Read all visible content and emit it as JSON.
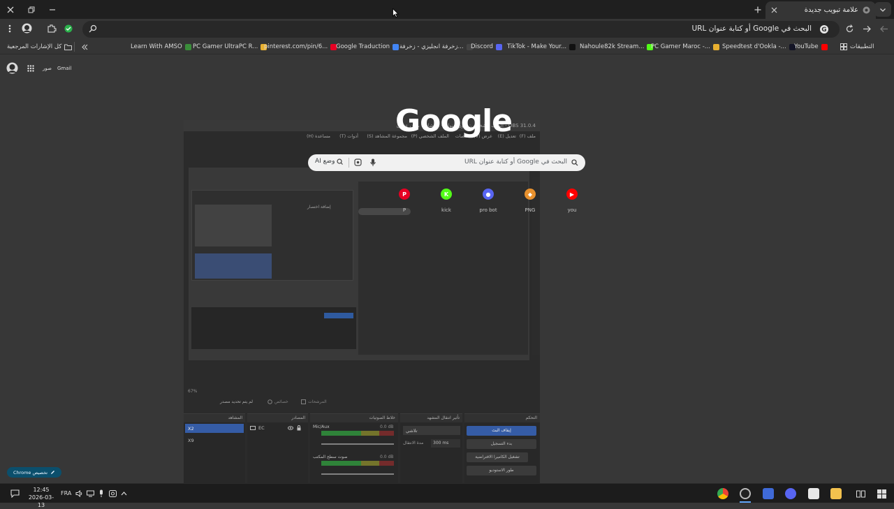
{
  "tabs": {
    "active_title": "علامة تبويب جديدة"
  },
  "omnibox": {
    "text": "البحث في Google أو كتابة عنوان URL"
  },
  "bookmarks": {
    "all_bookmarks": "كل الإشارات المرجعية",
    "apps": "التطبيقات",
    "items": [
      {
        "label": "Learn With AMSO",
        "color": "#3a8d3a"
      },
      {
        "label": "PC Gamer UltraPC R...",
        "color": "#e8b030"
      },
      {
        "label": "pinterest.com/pin/6...",
        "color": "#e60023"
      },
      {
        "label": "Google Traduction",
        "color": "#4285f4"
      },
      {
        "label": "زخرفة انجليزي - زخرفة...",
        "color": "#444444"
      },
      {
        "label": "Discord",
        "color": "#5865f2"
      },
      {
        "label": "TikTok - Make Your...",
        "color": "#111111"
      },
      {
        "label": "Nahoule82k Stream...",
        "color": "#53fc18"
      },
      {
        "label": "PC Gamer Maroc -...",
        "color": "#e8b030"
      },
      {
        "label": "Speedtest d'Ookla -...",
        "color": "#141526"
      },
      {
        "label": "YouTube",
        "color": "#ff0000"
      }
    ]
  },
  "ntp": {
    "gmail": "Gmail",
    "images": "صور",
    "logo": "Google",
    "search_placeholder": "البحث في Google أو كتابة عنوان URL",
    "ai_mode": "وضع AI",
    "shortcuts": [
      {
        "label": "you",
        "color": "#ff0000",
        "glyph": "▶"
      },
      {
        "label": "PNG",
        "color": "#e8912e",
        "glyph": "◆"
      },
      {
        "label": "pro bot",
        "color": "#5865f2",
        "glyph": "●"
      },
      {
        "label": "kick",
        "color": "#53fc18",
        "glyph": "K"
      },
      {
        "label": "P",
        "color": "#e60023",
        "glyph": "P"
      }
    ],
    "customize": "تخصيص Chrome"
  },
  "obs": {
    "title": "OBS 31.0.4 - الملف الشخصي: بدون عنوان - المشاهد: بدون عنوان",
    "menu": [
      "ملف (F)",
      "تعديل (E)",
      "عرض (V)",
      "المنصات",
      "الملف الشخصي (P)",
      "مجموعة المشاهد (S)",
      "أدوات (T)",
      "مساعدة (H)"
    ],
    "add_shortcut": "إضافة اختصار",
    "no_source": "لم يتم تحديد مصدر",
    "properties": "خصائص",
    "filters": "المرشحات",
    "docks": {
      "scenes": "المشاهد",
      "sources": "المصادر",
      "mixer": "خلاط الصوتيات",
      "transitions": "تأثير انتقال المشهد",
      "controls": "التحكم"
    },
    "scenes": [
      "X2",
      "X9"
    ],
    "sources": [
      "EC"
    ],
    "mixer": [
      {
        "name": "Mic/Aux",
        "db": "0.0 dB"
      },
      {
        "name": "صوت سطح المكتب",
        "db": "0.0 dB"
      }
    ],
    "transition": "تلاشي",
    "duration_label": "مدة الانتقال",
    "duration": "300 ms",
    "controls": [
      "إيقاف البث",
      "بدء التسجيل",
      "تشغيل الكاميرا الافتراضية",
      "طور الاستوديو"
    ],
    "zoom": "67%"
  },
  "taskbar": {
    "time": "12:45",
    "date": "2026-03-13",
    "lang": "FRA"
  },
  "colors": {
    "tabstrip": "#1f1f1f",
    "toolbar": "#353535",
    "page": "#373737",
    "accent": "#0b4f6c"
  }
}
